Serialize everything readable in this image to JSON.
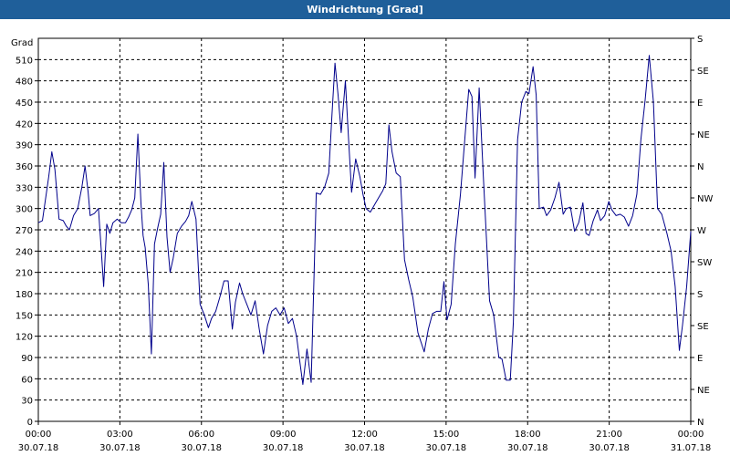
{
  "window": {
    "title": "Windrichtung [Grad]"
  },
  "colors": {
    "titlebar": "#1f5f9a",
    "line": "#00008b",
    "grid": "#000000",
    "background": "#ffffff"
  },
  "chart_data": {
    "type": "line",
    "title": "Windrichtung [Grad]",
    "ylabel": "Grad",
    "xlabel": "",
    "ylim": [
      0,
      540
    ],
    "xlim_hours": [
      0,
      24
    ],
    "grid": true,
    "yticks": [
      0,
      30,
      60,
      90,
      120,
      150,
      180,
      210,
      240,
      270,
      300,
      330,
      360,
      390,
      420,
      450,
      480,
      510
    ],
    "right_axis_labels": [
      "N",
      "NE",
      "E",
      "SE",
      "S",
      "SW",
      "W",
      "NW",
      "N",
      "NE",
      "E",
      "SE",
      "S"
    ],
    "x_ticks": [
      {
        "time": "00:00",
        "date": "30.07.18"
      },
      {
        "time": "03:00",
        "date": "30.07.18"
      },
      {
        "time": "06:00",
        "date": "30.07.18"
      },
      {
        "time": "09:00",
        "date": "30.07.18"
      },
      {
        "time": "12:00",
        "date": "30.07.18"
      },
      {
        "time": "15:00",
        "date": "30.07.18"
      },
      {
        "time": "18:00",
        "date": "30.07.18"
      },
      {
        "time": "21:00",
        "date": "30.07.18"
      },
      {
        "time": "00:00",
        "date": "31.07.18"
      }
    ],
    "series": [
      {
        "values": [
          [
            0.0,
            280
          ],
          [
            0.2,
            283
          ],
          [
            0.5,
            345
          ],
          [
            0.65,
            380
          ],
          [
            0.8,
            355
          ],
          [
            1.0,
            285
          ],
          [
            1.2,
            283
          ],
          [
            1.35,
            275
          ],
          [
            1.5,
            270
          ],
          [
            1.7,
            290
          ],
          [
            1.9,
            300
          ],
          [
            2.1,
            330
          ],
          [
            2.25,
            360
          ],
          [
            2.4,
            323
          ],
          [
            2.5,
            290
          ],
          [
            2.7,
            293
          ],
          [
            2.9,
            300
          ],
          [
            3.05,
            235
          ],
          [
            3.15,
            190
          ],
          [
            3.3,
            278
          ],
          [
            3.45,
            265
          ],
          [
            3.6,
            280
          ],
          [
            3.8,
            285
          ],
          [
            4.0,
            280
          ],
          [
            4.2,
            280
          ],
          [
            4.35,
            288
          ],
          [
            4.5,
            298
          ],
          [
            4.65,
            315
          ],
          [
            4.8,
            405
          ],
          [
            4.95,
            307
          ],
          [
            5.05,
            262
          ],
          [
            5.15,
            245
          ],
          [
            5.3,
            193
          ],
          [
            5.45,
            95
          ],
          [
            5.6,
            250
          ],
          [
            5.75,
            272
          ],
          [
            5.9,
            292
          ],
          [
            6.05,
            365
          ],
          [
            6.2,
            260
          ],
          [
            6.35,
            210
          ],
          [
            6.5,
            230
          ],
          [
            6.7,
            265
          ],
          [
            6.9,
            275
          ],
          [
            7.1,
            282
          ],
          [
            7.25,
            290
          ],
          [
            7.4,
            310
          ],
          [
            7.6,
            285
          ],
          [
            7.8,
            165
          ],
          [
            8.0,
            150
          ],
          [
            8.2,
            132
          ],
          [
            8.35,
            145
          ],
          [
            8.55,
            155
          ],
          [
            8.75,
            175
          ],
          [
            8.95,
            198
          ],
          [
            9.15,
            198
          ],
          [
            9.35,
            130
          ],
          [
            9.5,
            168
          ],
          [
            9.7,
            195
          ],
          [
            9.85,
            180
          ],
          [
            10.05,
            165
          ],
          [
            10.25,
            150
          ],
          [
            10.45,
            170
          ],
          [
            10.65,
            130
          ],
          [
            10.85,
            95
          ],
          [
            11.05,
            135
          ],
          [
            11.25,
            155
          ],
          [
            11.45,
            160
          ],
          [
            11.65,
            150
          ],
          [
            11.85,
            160
          ],
          [
            12.05,
            138
          ],
          [
            12.25,
            145
          ],
          [
            12.45,
            120
          ],
          [
            12.6,
            85
          ],
          [
            12.75,
            52
          ],
          [
            12.95,
            102
          ],
          [
            13.15,
            55
          ],
          [
            13.4,
            322
          ],
          [
            13.6,
            320
          ],
          [
            13.8,
            330
          ],
          [
            14.0,
            350
          ],
          [
            14.15,
            430
          ],
          [
            14.3,
            505
          ],
          [
            14.45,
            460
          ],
          [
            14.6,
            407
          ],
          [
            14.8,
            480
          ],
          [
            14.95,
            400
          ],
          [
            15.1,
            323
          ],
          [
            15.3,
            370
          ],
          [
            15.5,
            345
          ],
          [
            15.65,
            320
          ],
          [
            15.8,
            300
          ],
          [
            16.0,
            295
          ],
          [
            16.2,
            305
          ],
          [
            16.4,
            315
          ],
          [
            16.6,
            325
          ],
          [
            16.75,
            335
          ],
          [
            16.9,
            418
          ],
          [
            17.05,
            380
          ],
          [
            17.25,
            350
          ],
          [
            17.45,
            345
          ],
          [
            17.65,
            228
          ],
          [
            17.85,
            200
          ],
          [
            18.05,
            175
          ],
          [
            18.3,
            125
          ],
          [
            18.6,
            98
          ],
          [
            18.8,
            130
          ],
          [
            19.0,
            152
          ],
          [
            19.2,
            155
          ],
          [
            19.4,
            155
          ],
          [
            19.55,
            197
          ],
          [
            19.7,
            143
          ],
          [
            19.9,
            165
          ],
          [
            20.1,
            250
          ],
          [
            20.35,
            320
          ],
          [
            20.55,
            395
          ],
          [
            20.75,
            468
          ],
          [
            20.9,
            458
          ],
          [
            21.05,
            343
          ],
          [
            21.25,
            470
          ],
          [
            21.45,
            345
          ],
          [
            21.75,
            170
          ],
          [
            21.95,
            150
          ],
          [
            22.2,
            90
          ],
          [
            22.35,
            88
          ],
          [
            22.55,
            58
          ],
          [
            22.75,
            58
          ],
          [
            22.9,
            140
          ],
          [
            23.1,
            397
          ],
          [
            23.3,
            450
          ],
          [
            23.5,
            465
          ],
          [
            23.65,
            462
          ],
          [
            23.85,
            500
          ],
          [
            24.0,
            460
          ],
          [
            24.15,
            300
          ],
          [
            24.35,
            302
          ],
          [
            24.5,
            290
          ],
          [
            24.7,
            298
          ],
          [
            24.9,
            315
          ],
          [
            25.1,
            337
          ],
          [
            25.3,
            292
          ],
          [
            25.45,
            300
          ],
          [
            25.65,
            302
          ],
          [
            25.85,
            268
          ],
          [
            26.05,
            280
          ],
          [
            26.25,
            308
          ],
          [
            26.4,
            265
          ],
          [
            26.55,
            262
          ],
          [
            26.75,
            283
          ],
          [
            26.95,
            298
          ],
          [
            27.1,
            283
          ],
          [
            27.3,
            290
          ],
          [
            27.5,
            310
          ],
          [
            27.65,
            298
          ],
          [
            27.85,
            290
          ],
          [
            28.05,
            292
          ],
          [
            28.25,
            288
          ],
          [
            28.45,
            275
          ],
          [
            28.65,
            290
          ],
          [
            28.85,
            320
          ],
          [
            29.05,
            398
          ],
          [
            29.25,
            453
          ],
          [
            29.45,
            516
          ],
          [
            29.65,
            450
          ],
          [
            29.85,
            300
          ],
          [
            30.05,
            292
          ],
          [
            30.3,
            265
          ],
          [
            30.5,
            240
          ],
          [
            30.7,
            190
          ],
          [
            30.9,
            100
          ],
          [
            31.05,
            135
          ],
          [
            31.25,
            190
          ],
          [
            31.45,
            268
          ]
        ]
      }
    ]
  }
}
